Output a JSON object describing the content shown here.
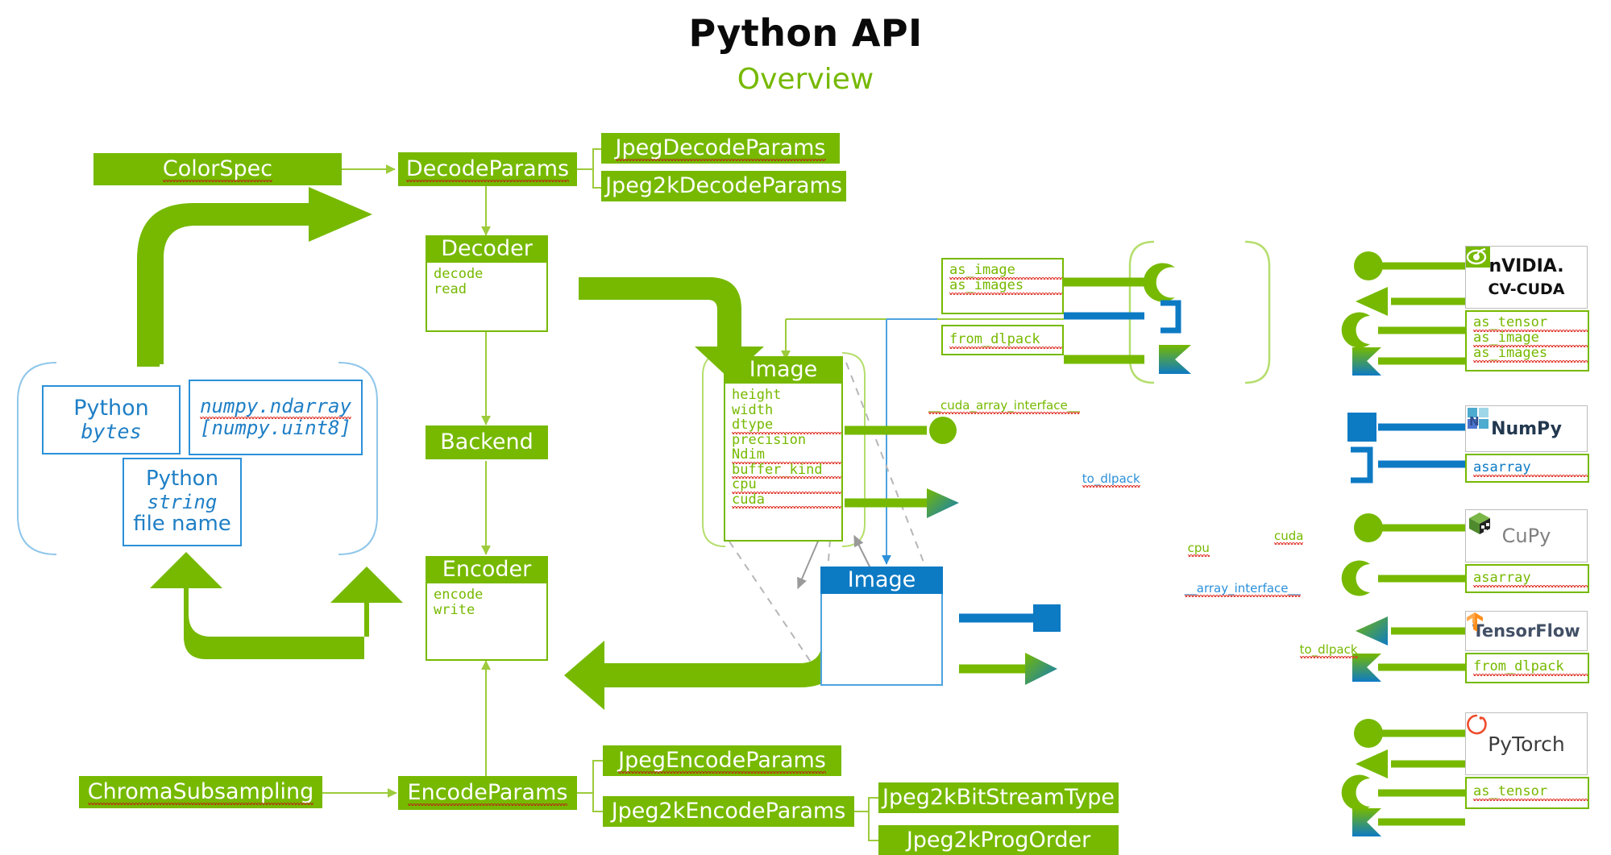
{
  "header": {
    "title": "Python API",
    "subtitle": "Overview"
  },
  "colors": {
    "nvidia_green": "#76b900",
    "blue": "#0d7ac4",
    "light_blue": "#2b90d9",
    "spell_red": "#e03a2f",
    "black": "#0a0a0a"
  },
  "decode_branch": {
    "color_spec": "ColorSpec",
    "decode_params": "DecodeParams",
    "jpeg_decode_params": "JpegDecodeParams",
    "jpeg2k_decode_params": "Jpeg2kDecodeParams"
  },
  "encode_branch": {
    "chroma_subsampling": "ChromaSubsampling",
    "encode_params": "EncodeParams",
    "jpeg_encode_params": "JpegEncodeParams",
    "jpeg2k_encode_params": "Jpeg2kEncodeParams",
    "jpeg2k_bitstream_type": "Jpeg2kBitStreamType",
    "jpeg2k_prog_order": "Jpeg2kProgOrder"
  },
  "classes": {
    "decoder": {
      "title": "Decoder",
      "methods": [
        "decode",
        "read"
      ]
    },
    "encoder": {
      "title": "Encoder",
      "methods": [
        "encode",
        "write"
      ]
    },
    "backend": {
      "title": "Backend"
    },
    "image_green": {
      "title": "Image",
      "properties": [
        "height",
        "width",
        "dtype",
        "precision",
        "Ndim",
        "buffer_kind",
        "cpu",
        "cuda"
      ]
    },
    "image_blue": {
      "title": "Image",
      "properties": []
    }
  },
  "inputs": {
    "python_bytes": {
      "line1": "Python",
      "line2": "bytes"
    },
    "numpy_ndarray": {
      "line1": "numpy.ndarray",
      "line2": "[numpy.uint8]"
    },
    "python_string": {
      "line1": "Python",
      "line2": "string",
      "line3": "file name"
    }
  },
  "interop": {
    "as_image": "as_image",
    "as_images": "as_images",
    "from_dlpack": "from_dlpack",
    "cuda_array_interface": "__cuda_array_interface__",
    "array_interface": "__array_interface__",
    "to_dlpack_top": "to_dlpack",
    "to_dlpack_bottom": "to_dlpack",
    "cpu_label": "cpu",
    "cuda_label": "cuda"
  },
  "libraries": [
    {
      "name": "CV-CUDA",
      "logo_icon": "nvidia-eye-icon",
      "logo_text": "nVIDIA.",
      "logo_sub": "CV-CUDA",
      "methods": [
        "as_tensor",
        "as_image",
        "as_images"
      ],
      "method_color": "#76b900",
      "connectors": [
        "circle",
        "arrow-left",
        "crescent",
        "flag"
      ]
    },
    {
      "name": "NumPy",
      "logo_icon": "numpy-cube-icon",
      "logo_text": "NumPy",
      "logo_sub": "",
      "methods": [
        "asarray"
      ],
      "method_color": "#2b90d9",
      "connectors": [
        "square-blue",
        "bracket-blue"
      ]
    },
    {
      "name": "CuPy",
      "logo_icon": "cupy-cube-icon",
      "logo_text": "CuPy",
      "logo_sub": "",
      "methods": [
        "asarray"
      ],
      "method_color": "#76b900",
      "connectors": [
        "circle",
        "crescent"
      ]
    },
    {
      "name": "TensorFlow",
      "logo_icon": "tensorflow-icon",
      "logo_text": "TensorFlow",
      "logo_sub": "",
      "methods": [
        "from_dlpack"
      ],
      "method_color": "#76b900",
      "connectors": [
        "arrow-left-grad",
        "flag-grad"
      ]
    },
    {
      "name": "PyTorch",
      "logo_icon": "pytorch-flame-icon",
      "logo_text": "PyTorch",
      "logo_sub": "",
      "methods": [
        "as_tensor"
      ],
      "method_color": "#76b900",
      "connectors": [
        "circle",
        "arrow-left",
        "crescent",
        "flag-grad"
      ]
    }
  ]
}
